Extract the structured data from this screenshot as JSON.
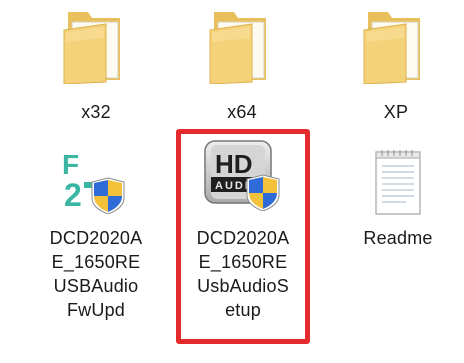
{
  "icons": [
    {
      "name": "x32",
      "type": "folder",
      "selected": false
    },
    {
      "name": "x64",
      "type": "folder",
      "selected": false
    },
    {
      "name": "XP",
      "type": "folder",
      "selected": false
    },
    {
      "name": "DCD2020A\nE_1650RE\nUSBAudio\nFwUpd",
      "type": "fw-installer",
      "icon_text": "FW2",
      "selected": false
    },
    {
      "name": "DCD2020A\nE_1650RE\nUsbAudioS\netup",
      "type": "hd-audio-installer",
      "icon_text": [
        "HD",
        "AUDIO"
      ],
      "selected": true
    },
    {
      "name": "Readme",
      "type": "text-document",
      "selected": false
    }
  ],
  "colors": {
    "highlight": "#e32b2b",
    "folder": "#f2cf72",
    "fw_logo": "#3bb6a3"
  }
}
